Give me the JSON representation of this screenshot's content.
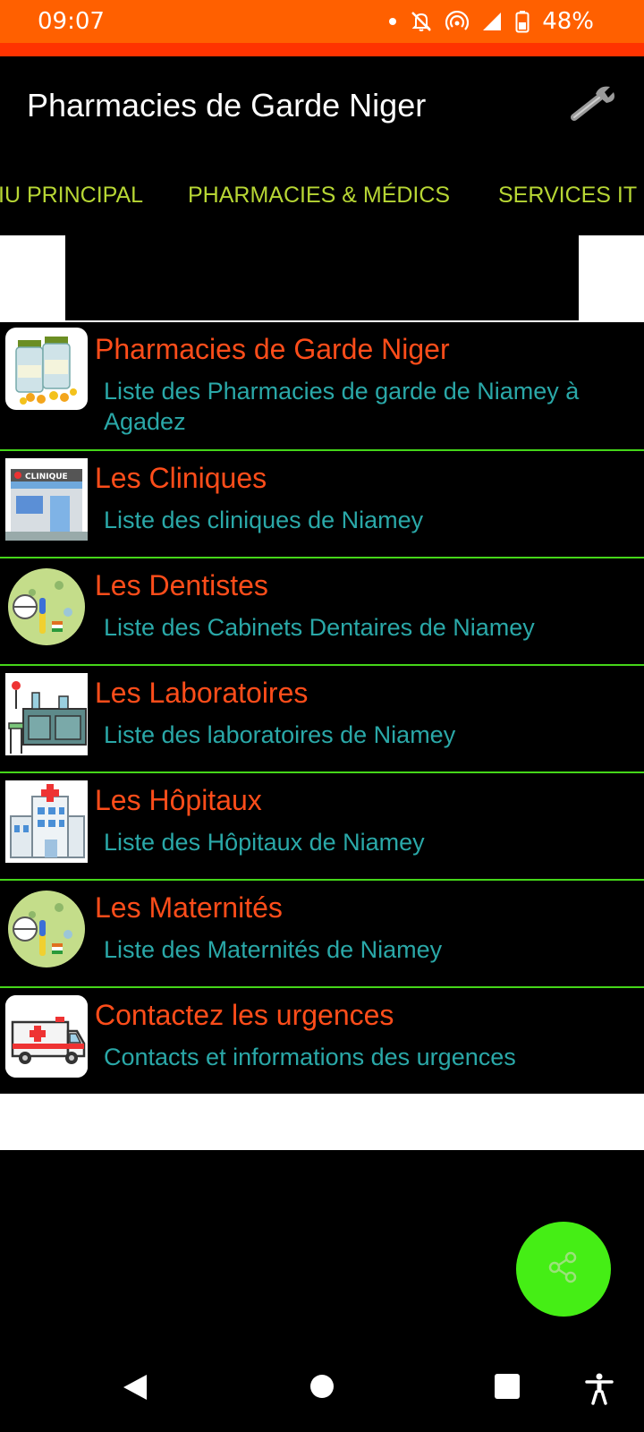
{
  "status": {
    "time": "09:07",
    "battery": "48%",
    "icons": [
      "dot-icon",
      "bell-off-icon",
      "hotspot-icon",
      "signal-icon",
      "battery-icon"
    ]
  },
  "appbar": {
    "title": "Pharmacies de Garde Niger",
    "settings_icon": "wrench-icon"
  },
  "tabs": [
    {
      "label": "IU PRINCIPAL"
    },
    {
      "label": "PHARMACIES & MÉDICS"
    },
    {
      "label": "SERVICES IT"
    }
  ],
  "items": [
    {
      "title": "Pharmacies de Garde Niger",
      "subtitle": "Liste des Pharmacies de garde de Niamey à Agadez",
      "icon": "vitamin-bottles-icon"
    },
    {
      "title": "Les Cliniques",
      "subtitle": "Liste des cliniques de Niamey",
      "icon": "clinic-building-icon",
      "icon_text": "CLINIQUE"
    },
    {
      "title": "Les Dentistes",
      "subtitle": "Liste des Cabinets Dentaires de Niamey",
      "icon": "medical-globe-icon"
    },
    {
      "title": "Les Laboratoires",
      "subtitle": "Liste des laboratoires de Niamey",
      "icon": "laboratory-icon"
    },
    {
      "title": "Les Hôpitaux",
      "subtitle": "Liste des Hôpitaux de Niamey",
      "icon": "hospital-icon"
    },
    {
      "title": "Les Maternités",
      "subtitle": "Liste des Maternités de Niamey",
      "icon": "medical-globe-icon"
    },
    {
      "title": "Contactez les urgences",
      "subtitle": "Contacts et informations des urgences",
      "icon": "ambulance-icon"
    }
  ],
  "fab": {
    "icon": "share-icon"
  },
  "nav": [
    "back-icon",
    "home-icon",
    "recents-icon",
    "accessibility-icon"
  ],
  "colors": {
    "status_bar": "#ff6000",
    "tab_text": "#b7d634",
    "item_title": "#ff4d1a",
    "item_subtitle": "#2aa8a8",
    "divider": "#45d619",
    "fab": "#45ee15"
  }
}
